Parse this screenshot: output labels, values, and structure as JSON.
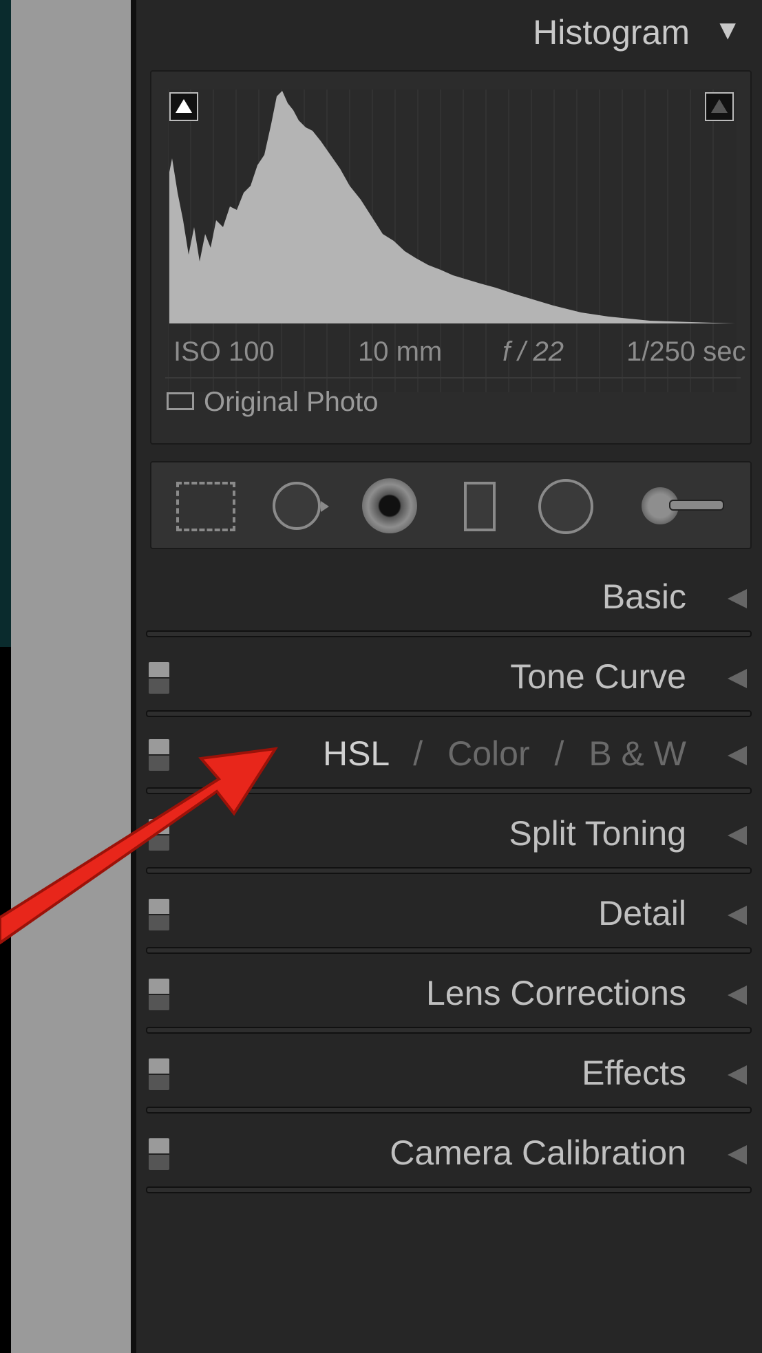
{
  "histogram": {
    "title": "Histogram",
    "collapse_glyph": "▼",
    "iso": "ISO 100",
    "focal_length": "10 mm",
    "aperture": "f / 22",
    "shutter": "1/250 sec",
    "original_photo_label": "Original Photo"
  },
  "tools": [
    {
      "icon": "crop-overlay-icon"
    },
    {
      "icon": "spot-removal-icon"
    },
    {
      "icon": "red-eye-correction-icon"
    },
    {
      "icon": "graduated-filter-icon"
    },
    {
      "icon": "radial-filter-icon"
    },
    {
      "icon": "adjustment-brush-icon"
    }
  ],
  "sections": {
    "basic": "Basic",
    "tone_curve": "Tone Curve",
    "hsl": "HSL",
    "hsl_sep1": "/",
    "color": "Color",
    "hsl_sep2": "/",
    "bw": "B & W",
    "split_toning": "Split Toning",
    "detail": "Detail",
    "lens_corrections": "Lens Corrections",
    "effects": "Effects",
    "camera_calibration": "Camera Calibration"
  },
  "colors": {
    "panel_bg": "#262626",
    "text": "#c0c0c0",
    "annotation_arrow": "#e8261b"
  }
}
